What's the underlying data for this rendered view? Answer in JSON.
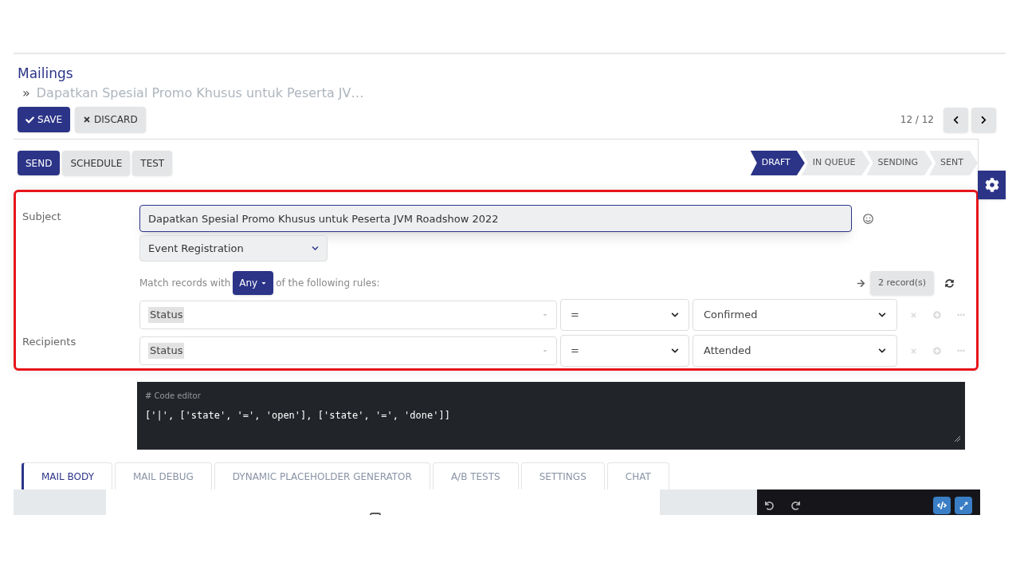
{
  "header": {
    "title": "Mailings",
    "breadcrumb_separator": "»",
    "breadcrumb": "Dapatkan Spesial Promo Khusus untuk Peserta JV…",
    "pager": "12 / 12"
  },
  "buttons": [
    {
      "label": "SAVE",
      "kind": "primary"
    },
    {
      "label": "DISCARD",
      "kind": "secondary"
    }
  ],
  "actions": [
    {
      "label": "SEND",
      "kind": "primary"
    },
    {
      "label": "SCHEDULE",
      "kind": "secondary"
    },
    {
      "label": "TEST",
      "kind": "secondary"
    }
  ],
  "statuses": [
    {
      "label": "DRAFT",
      "selected": true
    },
    {
      "label": "IN QUEUE",
      "selected": false
    },
    {
      "label": "SENDING",
      "selected": false
    },
    {
      "label": "SENT",
      "selected": false
    }
  ],
  "form": {
    "subject_label": "Subject",
    "subject": "Dapatkan Spesial Promo Khusus untuk Peserta JVM Roadshow 2022",
    "recipients_label": "Recipients",
    "model": "Event Registration",
    "match_prefix": "Match records with",
    "match_mode": "Any",
    "match_suffix": "of the following rules:",
    "record_count": "2 record(s)",
    "rules": [
      {
        "field": "Status",
        "operator": "=",
        "value": "Confirmed"
      },
      {
        "field": "Status",
        "operator": "=",
        "value": "Attended"
      }
    ]
  },
  "code_editor": {
    "label": "# Code editor",
    "code": "['|', ['state', '=', 'open'], ['state', '=', 'done']]"
  },
  "tabs": [
    {
      "label": "MAIL BODY",
      "selected": true
    },
    {
      "label": "MAIL DEBUG",
      "selected": false
    },
    {
      "label": "DYNAMIC PLACEHOLDER GENERATOR",
      "selected": false
    },
    {
      "label": "A/B TESTS",
      "selected": false
    },
    {
      "label": "SETTINGS",
      "selected": false
    },
    {
      "label": "CHAT",
      "selected": false
    }
  ]
}
